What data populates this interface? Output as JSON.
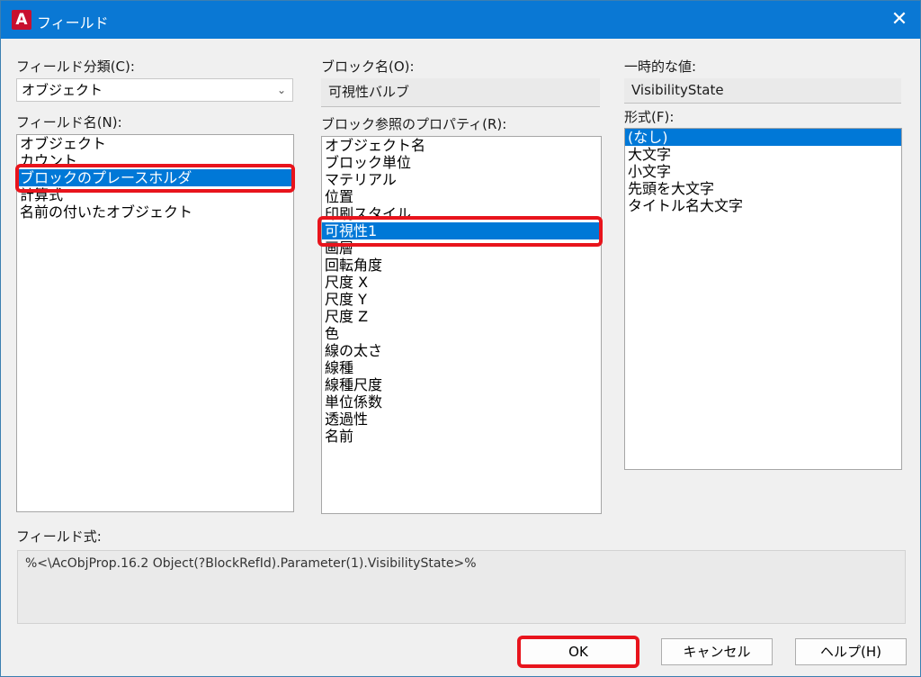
{
  "window": {
    "title": "フィールド",
    "app_icon_letter": "A",
    "close_glyph": "✕",
    "icons": {
      "app": "autocad-icon",
      "close": "close-icon",
      "dropdown": "chevron-down-icon"
    }
  },
  "left": {
    "category_label": "フィールド分類(C):",
    "category_value": "オブジェクト",
    "field_name_label": "フィールド名(N):",
    "field_names": [
      "オブジェクト",
      "カウント",
      "ブロックのプレースホルダ",
      "計算式",
      "名前の付いたオブジェクト"
    ],
    "selected_index": 2
  },
  "middle": {
    "block_name_label": "ブロック名(O):",
    "block_name_value": "可視性バルブ",
    "properties_label": "ブロック参照のプロパティ(R):",
    "properties": [
      "オブジェクト名",
      "ブロック単位",
      "マテリアル",
      "位置",
      "印刷スタイル",
      "可視性1",
      "画層",
      "回転角度",
      "尺度 X",
      "尺度 Y",
      "尺度 Z",
      "色",
      "線の太さ",
      "線種",
      "線種尺度",
      "単位係数",
      "透過性",
      "名前"
    ],
    "selected_index": 5
  },
  "right": {
    "temp_value_label": "一時的な値:",
    "temp_value": "VisibilityState",
    "format_label": "形式(F):",
    "formats": [
      "(なし)",
      "大文字",
      "小文字",
      "先頭を大文字",
      "タイトル名大文字"
    ],
    "selected_index": 0
  },
  "expression": {
    "label": "フィールド式:",
    "value": "%<\\AcObjProp.16.2 Object(?BlockRefId).Parameter(1).VisibilityState>%"
  },
  "buttons": {
    "ok": "OK",
    "cancel": "キャンセル",
    "help": "ヘルプ(H)"
  },
  "colors": {
    "titlebar": "#0a78d4",
    "selection": "#0078d7",
    "highlight": "#e8141c"
  }
}
